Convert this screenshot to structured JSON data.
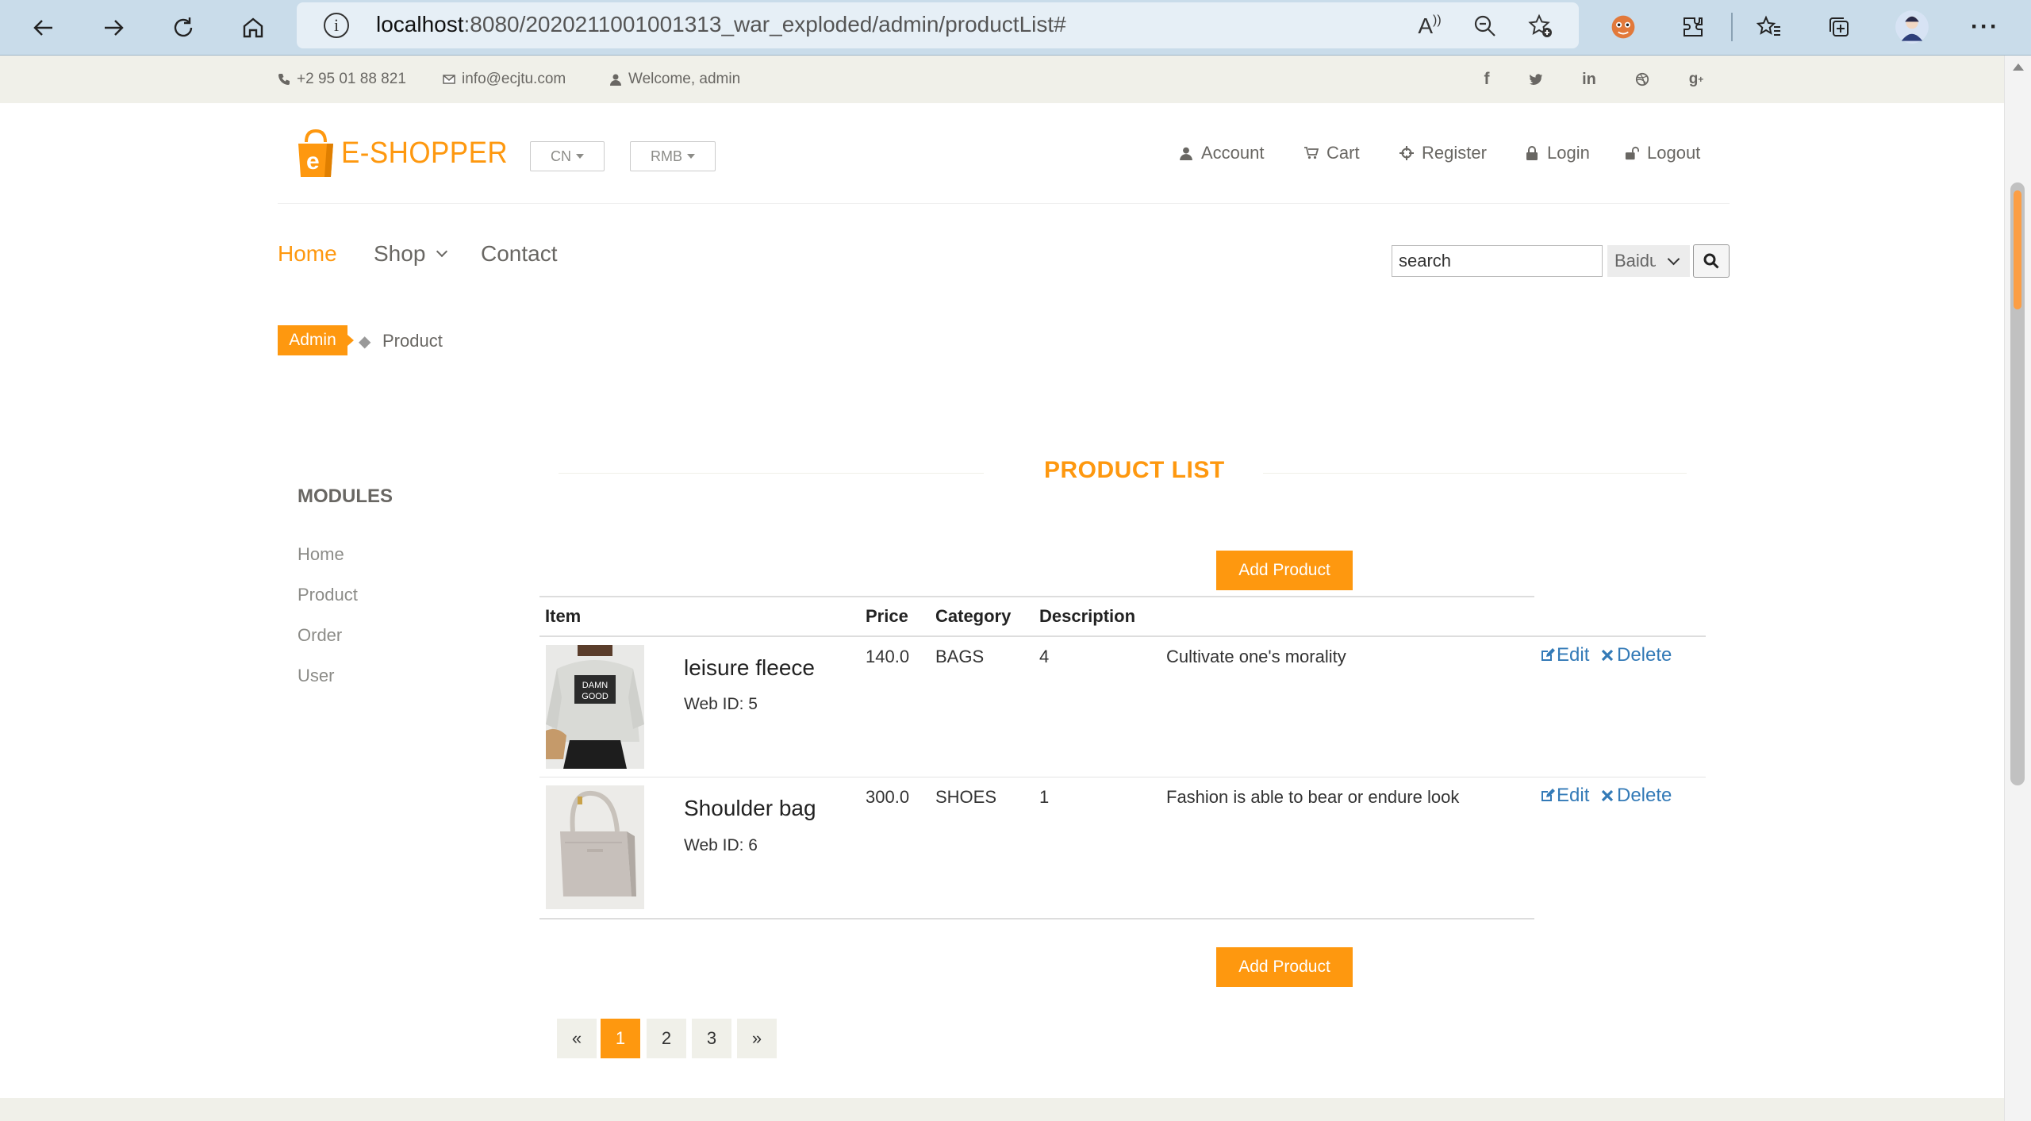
{
  "browser": {
    "url_host": "localhost",
    "url_rest": ":8080/2020211001001313_war_exploded/admin/productList#"
  },
  "topbar": {
    "phone": "+2 95 01 88 821",
    "email": "info@ecjtu.com",
    "welcome": "Welcome, admin",
    "social": [
      "f",
      "t",
      "in",
      "dribbble",
      "g+"
    ]
  },
  "header": {
    "logo_text_accent": "e",
    "logo_text": "E-SHOPPER",
    "language": "CN",
    "currency": "RMB",
    "links": [
      "Account",
      "Cart",
      "Register",
      "Login",
      "Logout"
    ]
  },
  "nav": {
    "home": "Home",
    "shop": "Shop",
    "contact": "Contact",
    "search_value": "search",
    "engine": "Baidu"
  },
  "breadcrumb": {
    "admin": "Admin",
    "sep": "◆",
    "current": "Product"
  },
  "sidebar": {
    "title": "MODULES",
    "items": [
      "Home",
      "Product",
      "Order",
      "User"
    ]
  },
  "main": {
    "title": "PRODUCT LIST",
    "add_label": "Add Product",
    "columns": [
      "Item",
      "Price",
      "Category",
      "Description"
    ],
    "rows": [
      {
        "name": "leisure fleece",
        "web_id": "Web ID: 5",
        "price": "140.0",
        "category": "BAGS",
        "count": "4",
        "description": "Cultivate one's morality",
        "edit": "Edit",
        "delete": "Delete"
      },
      {
        "name": "Shoulder bag",
        "web_id": "Web ID: 6",
        "price": "300.0",
        "category": "SHOES",
        "count": "1",
        "description": "Fashion is able to bear or endure look",
        "edit": "Edit",
        "delete": "Delete"
      }
    ]
  },
  "pagination": [
    "«",
    "1",
    "2",
    "3",
    "»"
  ],
  "colors": {
    "accent": "#fe980f",
    "text": "#696763",
    "link": "#337ab7",
    "band": "#f0f0e9"
  }
}
